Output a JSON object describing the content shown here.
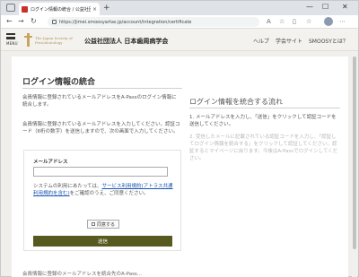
{
  "browser": {
    "tab_title": "ログイン情報の統合 / 公益社団法人 日",
    "tab_close": "×",
    "new_tab": "+",
    "url": "https://jimei.smoosyartas.jp/account/integration/certificate",
    "controls": {
      "minimize": "—",
      "maximize": "☐",
      "close": "✕"
    },
    "nav": {
      "back": "←",
      "forward": "→",
      "reload": "↻"
    }
  },
  "header": {
    "menu_label": "MENU",
    "logo_line1": "The Japan Society of",
    "logo_line2": "Periodontology",
    "org_name": "公益社団法人 日本歯周病学会",
    "nav": [
      "ヘルプ",
      "学会サイト",
      "SMOOSYとは？"
    ]
  },
  "main": {
    "title": "ログイン情報の統合",
    "intro1": "会員情報に登録されているメールアドレスをA-Passのログイン情報に統合します。",
    "intro2": "会員情報に登録されているメールアドレスを入力してください。認証コード（6桁の数字）を送信しますので、次の画面で入力してください。",
    "form": {
      "email_label": "メールアドレス",
      "email_value": "",
      "email_placeholder": "",
      "terms_prefix": "システムの利用にあたっては、",
      "terms_link": "サービス利用規約(アトラス共通利用規約を含む)",
      "terms_suffix": "をご確認のうえ、ご同意ください。",
      "agree_label": "同意する",
      "submit_label": "送信"
    },
    "bottom_text": "会員情報に登録のメールアドレスを統合先のA-Pass..."
  },
  "side": {
    "title": "ログイン情報を統合する流れ",
    "step1": "1. メールアドレスを入力し、「送信」をクリックして認証コードを送信してください。",
    "step2": "2. 受信したメールに記載されている認証コードを入力し、「認証してログイン情報を統合する」をクリックして認証してください。認証するとマイページに戻ります。今後はA-Passでログインしてください。"
  },
  "colors": {
    "submit_bg": "#575a1f",
    "link": "#1a55b5",
    "header_bg": "#f4f2ee"
  }
}
